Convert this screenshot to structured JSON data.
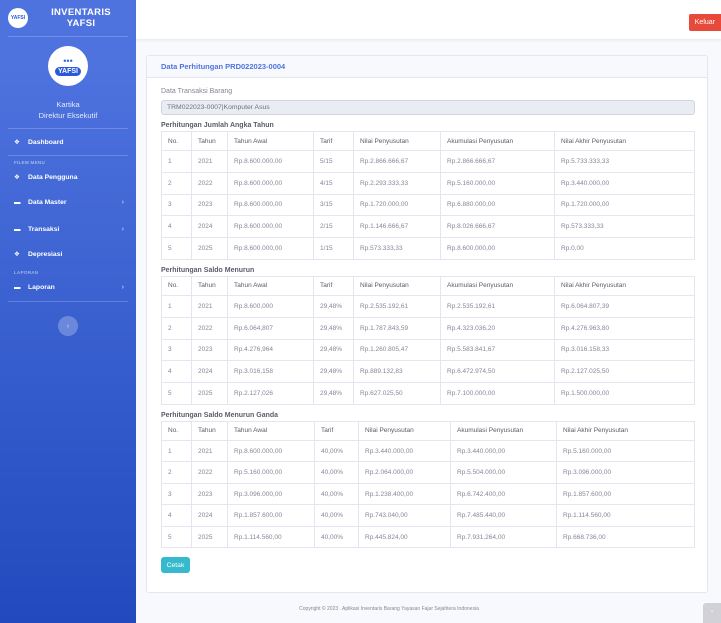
{
  "brand": {
    "logo_text": "YAFSI",
    "line1": "INVENTARIS",
    "line2": "YAFSI"
  },
  "profile": {
    "logo_text": "YAFSI",
    "name": "Kartika",
    "role": "Direktur Eksekutif"
  },
  "nav": {
    "dashboard": "Dashboard",
    "heading_filem": "FILEM MENU",
    "data_pengguna": "Data Pengguna",
    "data_master": "Data Master",
    "transaksi": "Transaksi",
    "depresiasi": "Depresiasi",
    "heading_laporan": "LAPORAN",
    "laporan": "Laporan"
  },
  "topbar": {
    "logout": "Keluar"
  },
  "card": {
    "title": "Data Perhitungan PRD022023-0004",
    "field_label": "Data Transaksi Barang",
    "field_value": "TRM022023-0007|Komputer Asus",
    "cetak": "Cetak"
  },
  "table1": {
    "title": "Perhitungan Jumlah Angka Tahun",
    "headers": [
      "No.",
      "Tahun",
      "Tahun Awal",
      "Tarif",
      "Nilai Penyusutan",
      "Akumulasi Penyusutan",
      "Nilai Akhir Penyusutan"
    ],
    "rows": [
      [
        "1",
        "2021",
        "Rp.8.600.000,00",
        "5/15",
        "Rp.2.866.666,67",
        "Rp.2.866.666,67",
        "Rp.5.733.333,33"
      ],
      [
        "2",
        "2022",
        "Rp.8.600.000,00",
        "4/15",
        "Rp.2.293.333,33",
        "Rp.5.160.000,00",
        "Rp.3.440.000,00"
      ],
      [
        "3",
        "2023",
        "Rp.8.600.000,00",
        "3/15",
        "Rp.1.720.000,00",
        "Rp.6.880.000,00",
        "Rp.1.720.000,00"
      ],
      [
        "4",
        "2024",
        "Rp.8.600.000,00",
        "2/15",
        "Rp.1.146.666,67",
        "Rp.8.026.666,67",
        "Rp.573.333,33"
      ],
      [
        "5",
        "2025",
        "Rp.8.600.000,00",
        "1/15",
        "Rp.573.333,33",
        "Rp.8.600.000,00",
        "Rp.0,00"
      ]
    ]
  },
  "table2": {
    "title": "Perhitungan Saldo Menurun",
    "headers": [
      "No.",
      "Tahun",
      "Tahun Awal",
      "Tarif",
      "Nilai Penyusutan",
      "Akumulasi Penyusutan",
      "Nilai Akhir Penyusutan"
    ],
    "rows": [
      [
        "1",
        "2021",
        "Rp.8.600,000",
        "29,48%",
        "Rp.2.535.192,61",
        "Rp.2.535.192,61",
        "Rp.6.064.807,39"
      ],
      [
        "2",
        "2022",
        "Rp.6.064,807",
        "29,48%",
        "Rp.1.787.843,59",
        "Rp.4.323.036,20",
        "Rp.4.276.963,80"
      ],
      [
        "3",
        "2023",
        "Rp.4.276,964",
        "29,48%",
        "Rp.1.260.805,47",
        "Rp.5.583.841,67",
        "Rp.3.016.158,33"
      ],
      [
        "4",
        "2024",
        "Rp.3.016,158",
        "29,48%",
        "Rp.889.132,83",
        "Rp.6.472.974,50",
        "Rp.2.127.025,50"
      ],
      [
        "5",
        "2025",
        "Rp.2.127,026",
        "29,48%",
        "Rp.627.025,50",
        "Rp.7.100.000,00",
        "Rp.1.500.000,00"
      ]
    ]
  },
  "table3": {
    "title": "Perhitungan Saldo Menurun Ganda",
    "headers": [
      "No.",
      "Tahun",
      "Tahun Awal",
      "Tarif",
      "Nilai Penyusutan",
      "Akumulasi Penyusutan",
      "Nilai Akhir Penyusutan"
    ],
    "rows": [
      [
        "1",
        "2021",
        "Rp.8.600.000,00",
        "40,00%",
        "Rp.3.440.000,00",
        "Rp.3.440.000,00",
        "Rp.5.160.000,00"
      ],
      [
        "2",
        "2022",
        "Rp.5.160.000,00",
        "40,00%",
        "Rp.2.064.000,00",
        "Rp.5.504.000,00",
        "Rp.3.096.000,00"
      ],
      [
        "3",
        "2023",
        "Rp.3.096.000,00",
        "40,00%",
        "Rp.1.238.400,00",
        "Rp.6.742.400,00",
        "Rp.1.857.600,00"
      ],
      [
        "4",
        "2024",
        "Rp.1.857.600,00",
        "40,00%",
        "Rp.743.040,00",
        "Rp.7.485.440,00",
        "Rp.1.114.560,00"
      ],
      [
        "5",
        "2025",
        "Rp.1.114.560,00",
        "40,00%",
        "Rp.445.824,00",
        "Rp.7.931.264,00",
        "Rp.668.736,00"
      ]
    ]
  },
  "footer": "Copyright © 2023 . Aplikasi Inventaris Barang Yayasan Fajar Sejahtera Indonesia"
}
